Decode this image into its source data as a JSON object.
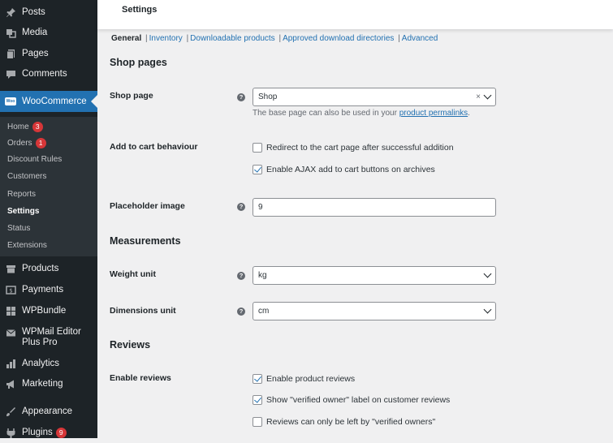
{
  "sidebar": {
    "top_items": [
      {
        "label": "Posts",
        "icon": "pin-icon"
      },
      {
        "label": "Media",
        "icon": "media-icon"
      },
      {
        "label": "Pages",
        "icon": "pages-icon"
      },
      {
        "label": "Comments",
        "icon": "comment-icon"
      }
    ],
    "woocommerce": {
      "label": "WooCommerce",
      "icon_text": "Woo"
    },
    "submenu": [
      {
        "label": "Home",
        "badge": "3"
      },
      {
        "label": "Orders",
        "badge": "1"
      },
      {
        "label": "Discount Rules"
      },
      {
        "label": "Customers"
      },
      {
        "label": "Reports"
      },
      {
        "label": "Settings"
      },
      {
        "label": "Status"
      },
      {
        "label": "Extensions"
      }
    ],
    "bottom_items": [
      {
        "label": "Products"
      },
      {
        "label": "Payments"
      },
      {
        "label": "WPBundle"
      },
      {
        "label": "WPMail Editor Plus Pro"
      },
      {
        "label": "Analytics"
      },
      {
        "label": "Marketing"
      },
      {
        "label": "Appearance"
      },
      {
        "label": "Plugins",
        "badge": "9"
      }
    ]
  },
  "header": {
    "title": "Settings"
  },
  "tabs": {
    "general": "General",
    "inventory": "Inventory",
    "downloadable": "Downloadable products",
    "approved": "Approved download directories",
    "advanced": "Advanced"
  },
  "shop_pages": {
    "heading": "Shop pages",
    "shop_page_label": "Shop page",
    "shop_page_value": "Shop",
    "clear_symbol": "×",
    "desc_prefix": "The base page can also be used in your ",
    "desc_link": "product permalinks",
    "desc_suffix": ".",
    "cart_label": "Add to cart behaviour",
    "redirect_label": "Redirect to the cart page after successful addition",
    "redirect_checked": false,
    "ajax_label": "Enable AJAX add to cart buttons on archives",
    "ajax_checked": true,
    "placeholder_label": "Placeholder image",
    "placeholder_value": "9"
  },
  "measurements": {
    "heading": "Measurements",
    "weight_label": "Weight unit",
    "weight_value": "kg",
    "dimensions_label": "Dimensions unit",
    "dimensions_value": "cm"
  },
  "reviews": {
    "heading": "Reviews",
    "enable_label": "Enable reviews",
    "enable_product_reviews": "Enable product reviews",
    "enable_checked": true,
    "verified_label": "Show \"verified owner\" label on customer reviews",
    "verified_checked": true,
    "only_verified": "Reviews can only be left by \"verified owners\"",
    "only_verified_checked": false
  },
  "help_symbol": "?",
  "colors": {
    "accent": "#2271b1",
    "sidebar": "#1d2327",
    "badge": "#d63638"
  }
}
